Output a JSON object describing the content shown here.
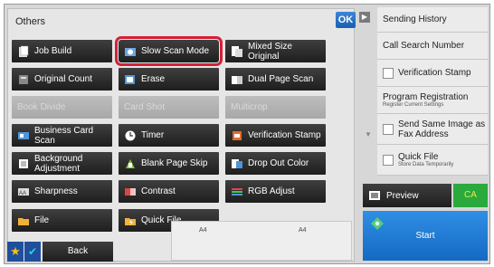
{
  "panel": {
    "title": "Others",
    "ok_label": "OK"
  },
  "grid": {
    "row1": {
      "job_build": "Job Build",
      "slow_scan": "Slow Scan Mode",
      "mixed_size": "Mixed Size Original"
    },
    "row2": {
      "original_count": "Original Count",
      "erase": "Erase",
      "dual_page": "Dual Page Scan"
    },
    "row3": {
      "book_divide": "Book Divide",
      "card_shot": "Card Shot",
      "multicrop": "Multicrop"
    },
    "row4": {
      "business_card": "Business Card Scan",
      "timer": "Timer",
      "verification_stamp": "Verification Stamp"
    },
    "row5": {
      "background_adjustment": "Background Adjustment",
      "blank_page_skip": "Blank Page Skip",
      "drop_out_color": "Drop Out Color"
    },
    "row6": {
      "sharpness": "Sharpness",
      "contrast": "Contrast",
      "rgb_adjust": "RGB Adjust"
    },
    "row7": {
      "file": "File",
      "quick_file": "Quick File"
    }
  },
  "bottom": {
    "back_label": "Back",
    "paper_left": "A4",
    "paper_right": "A4"
  },
  "right_panel": {
    "sending_history": "Sending History",
    "call_search_number": "Call Search Number",
    "verification_stamp": "Verification Stamp",
    "program_registration": "Program Registration",
    "program_registration_sub": "Register Current Settings",
    "send_same_image": "Send Same Image as Fax Address",
    "quick_file": "Quick File",
    "quick_file_sub": "Store Data Temporarily"
  },
  "actions": {
    "preview_label": "Preview",
    "ca_label": "CA",
    "start_label": "Start"
  },
  "icons": {
    "job_build": "job-build-icon",
    "slow_scan": "slow-scan-icon",
    "mixed_size": "mixed-size-icon",
    "original_count": "original-count-icon",
    "erase": "erase-icon",
    "dual_page": "dual-page-icon",
    "business_card": "business-card-icon",
    "timer": "timer-icon",
    "verification_stamp": "stamp-icon",
    "background_adjustment": "background-adjust-icon",
    "blank_page_skip": "blank-page-icon",
    "drop_out_color": "drop-out-color-icon",
    "sharpness": "sharpness-icon",
    "contrast": "contrast-icon",
    "rgb_adjust": "rgb-adjust-icon",
    "file": "folder-icon",
    "quick_file": "quick-file-icon"
  },
  "colors": {
    "highlight": "#d61f38",
    "ok": "#1a5fb1",
    "start": "#1569c2",
    "ca": "#2aaa3c"
  }
}
